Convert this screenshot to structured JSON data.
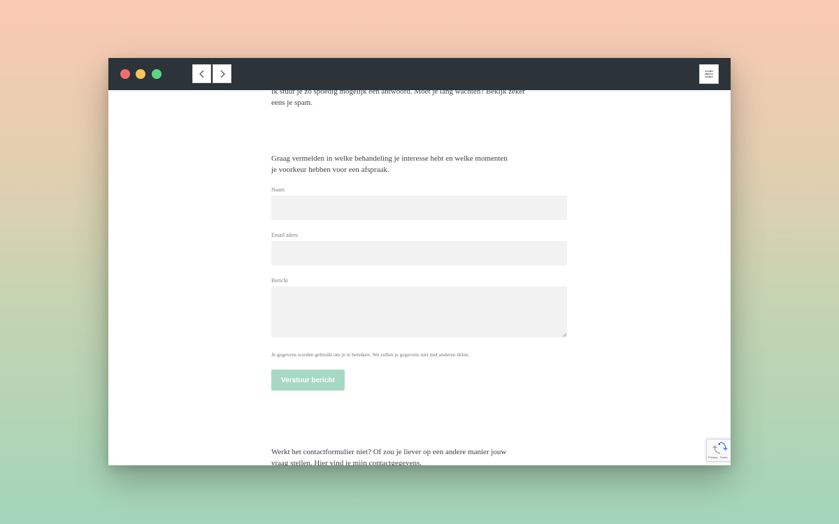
{
  "window": {
    "background": "#ffffff",
    "titlebar_color": "#2c3339",
    "traffic_lights": [
      "#f26e6e",
      "#f6c65b",
      "#5cd584"
    ]
  },
  "toolbar": {
    "back_icon": "chevron-left-icon",
    "forward_icon": "chevron-right-icon",
    "menu_icon": "sliders-icon"
  },
  "page": {
    "top_text": "Ik stuur je zo spoedig mogelijk een antwoord. Moet je lang wachten? Bekijk zeker eens je spam.",
    "intro_text": "Graag vermelden in welke behandeling je interesse hebt en welke momenten je voorkeur hebben voor een afspraak.",
    "bottom_text": "Werkt het contactformulier niet? Of zou je liever op een andere manier jouw vraag stellen. Hier vind je mijn contactgegevens."
  },
  "form": {
    "name_label": "Naam",
    "name_value": "",
    "email_label": "Email adres",
    "email_value": "",
    "message_label": "Bericht",
    "message_value": "",
    "privacy_note": "Je gegevens worden gebruikt om je te bereiken. We zullen je gegevens niet met anderen delen.",
    "submit_label": "Verstuur bericht",
    "submit_color": "#a6d9c3"
  },
  "recaptcha": {
    "terms_text": "Privacy - Terms"
  }
}
